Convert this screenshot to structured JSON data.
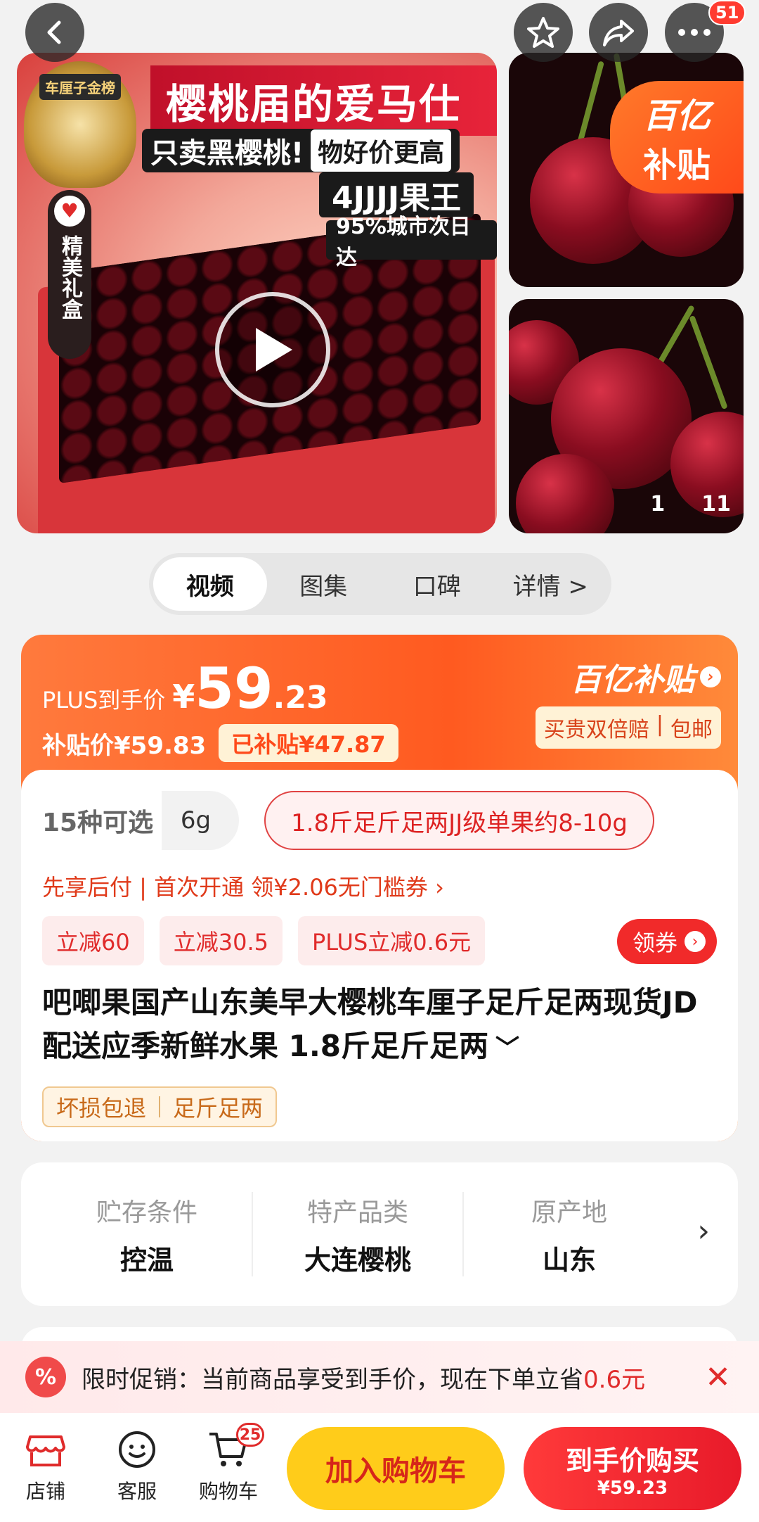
{
  "colors": {
    "accent_red": "#e02b2b",
    "subsidy_orange": "#ff5a20",
    "cart_yellow": "#ffcc1a"
  },
  "top_bar": {
    "back_icon": "chevron-left-icon",
    "favorite_icon": "star-icon",
    "share_icon": "share-icon",
    "more_icon": "more-icon",
    "message_badge": "51"
  },
  "gallery": {
    "title": "樱桃届的爱马仕",
    "sub_a": "只卖黑樱桃!",
    "sub_b": "物好价更高",
    "king": "4JJJJ果王",
    "nextday": "95%城市次日达",
    "rank": "车厘子金榜",
    "gift_tag": "精美礼盒",
    "subsidy_1": "百亿",
    "subsidy_2": "补贴",
    "counter_current": "1",
    "counter_total": "11"
  },
  "tabs": [
    {
      "label": "视频",
      "active": true
    },
    {
      "label": "图集",
      "active": false
    },
    {
      "label": "口碑",
      "active": false
    },
    {
      "label": "详情 >",
      "active": false
    }
  ],
  "price": {
    "plus_label": "PLUS到手价",
    "currency": "¥",
    "integer": "59",
    "decimal": ".23",
    "subsidy_price": "补贴价¥59.83",
    "subsidy_amount": "已补贴¥47.87",
    "brand": "百亿补贴",
    "guarantee_a": "买贵双倍赔",
    "guarantee_b": "包邮"
  },
  "spec": {
    "count": "15种可选",
    "ghost_chip": "6g",
    "selected": "1.8斤足斤足两JJ级单果约8-10g"
  },
  "pay_line": "先享后付 | 首次开通 领¥2.06无门槛券 ›",
  "promos": [
    "立减60",
    "立减30.5",
    "PLUS立减0.6元"
  ],
  "coupon_label": "领券",
  "product_title": "吧唧果国产山东美早大樱桃车厘子足斤足两现货JD配送应季新鲜水果 1.8斤足斤足两",
  "tags": [
    "坏损包退",
    "足斤足两"
  ],
  "attributes": [
    {
      "key": "贮存条件",
      "value": "控温"
    },
    {
      "key": "特产品类",
      "value": "大连樱桃"
    },
    {
      "key": "原产地",
      "value": "山东"
    }
  ],
  "promo_bar": {
    "icon": "percent-icon",
    "text": "限时促销：当前商品享受到手价，现在下单立省",
    "amount": "0.6元"
  },
  "bottom": {
    "shop": "店铺",
    "service": "客服",
    "cart": "购物车",
    "cart_count": "25",
    "add_to_cart": "加入购物车",
    "buy_line1": "到手价购买",
    "buy_line2": "¥59.23"
  }
}
